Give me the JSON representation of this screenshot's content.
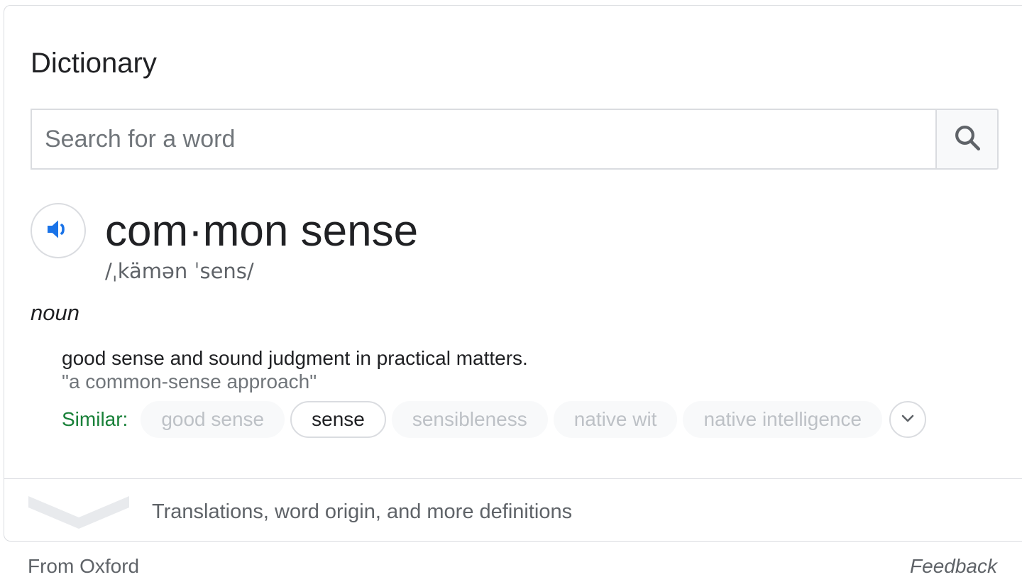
{
  "panel": {
    "title": "Dictionary"
  },
  "search": {
    "placeholder": "Search for a word",
    "value": "",
    "button_icon": "search-icon"
  },
  "entry": {
    "audio_icon": "speaker-icon",
    "headword": "com·mon sense",
    "pronunciation": "/ˌkämən ˈsens/",
    "part_of_speech": "noun",
    "definition": "good sense and sound judgment in practical matters.",
    "example": "\"a common-sense approach\"",
    "similar_label": "Similar:",
    "similar": [
      "good sense",
      "sense",
      "sensibleness",
      "native wit",
      "native intelligence"
    ],
    "similar_active_index": 1,
    "more_icon": "chevron-down-icon"
  },
  "expand": {
    "icon": "chevron-down-icon",
    "label": "Translations, word origin, and more definitions"
  },
  "footer": {
    "source": "From Oxford",
    "feedback": "Feedback"
  },
  "colors": {
    "accent_blue": "#1a73e8",
    "similar_green": "#188038",
    "border": "#dadce0",
    "muted_text": "#70757a"
  }
}
